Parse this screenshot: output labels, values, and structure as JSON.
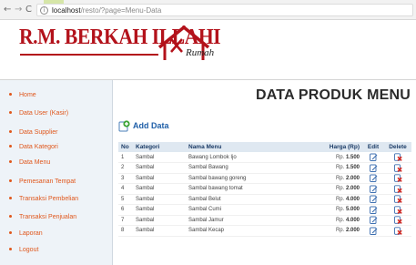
{
  "browser": {
    "nav": {
      "back": "←",
      "forward": "→",
      "reload": "C"
    },
    "url_host": "localhost",
    "url_path": "/resto/?page=Menu-Data"
  },
  "logo": {
    "title": "R.M. BERKAH ILLAHI",
    "script": "Rumah"
  },
  "sidebar": {
    "items": [
      {
        "label": "Home"
      },
      {
        "label": "Data User (Kasir)"
      },
      {
        "label": "Data Supplier"
      },
      {
        "label": "Data Kategori"
      },
      {
        "label": "Data Menu"
      },
      {
        "label": "Pemesanan Tempat"
      },
      {
        "label": "Transaksi Pembelian"
      },
      {
        "label": "Transaksi Penjualan"
      },
      {
        "label": "Laporan"
      },
      {
        "label": "Logout"
      }
    ]
  },
  "main": {
    "heading": "DATA PRODUK MENU",
    "add_label": "Add Data",
    "table": {
      "headers": {
        "no": "No",
        "kategori": "Kategori",
        "nama": "Nama Menu",
        "harga": "Harga (Rp)",
        "edit": "Edit",
        "delete": "Delete"
      },
      "rows": [
        {
          "no": "1",
          "kategori": "Sambal",
          "nama": "Bawang Lombok Ijo",
          "rp": "Rp.",
          "harga": "1.500"
        },
        {
          "no": "2",
          "kategori": "Sambal",
          "nama": "Sambal Bawang",
          "rp": "Rp.",
          "harga": "1.500"
        },
        {
          "no": "3",
          "kategori": "Sambal",
          "nama": "Sambal bawang goreng",
          "rp": "Rp.",
          "harga": "2.000"
        },
        {
          "no": "4",
          "kategori": "Sambal",
          "nama": "Sambal bawang tomat",
          "rp": "Rp.",
          "harga": "2.000"
        },
        {
          "no": "5",
          "kategori": "Sambal",
          "nama": "Sambal Belut",
          "rp": "Rp.",
          "harga": "4.000"
        },
        {
          "no": "6",
          "kategori": "Sambal",
          "nama": "Sambal Cumi",
          "rp": "Rp.",
          "harga": "5.000"
        },
        {
          "no": "7",
          "kategori": "Sambal",
          "nama": "Sambal Jamur",
          "rp": "Rp.",
          "harga": "4.000"
        },
        {
          "no": "8",
          "kategori": "Sambal",
          "nama": "Sambal Kecap",
          "rp": "Rp.",
          "harga": "2.000"
        }
      ]
    }
  },
  "colors": {
    "brand_red": "#b3121b",
    "menu_orange": "#e0571c",
    "link_blue": "#1f5fa8",
    "header_bg": "#dfe8f1",
    "delete_red": "#d9261c"
  },
  "icons": {
    "add": "plus-circle-icon",
    "edit": "pencil-edit-icon",
    "delete": "trash-delete-icon"
  }
}
